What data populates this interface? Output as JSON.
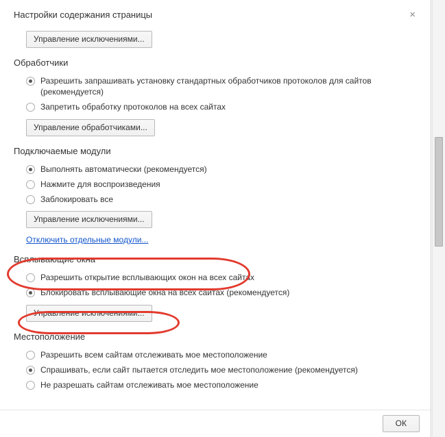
{
  "dialog": {
    "title": "Настройки содержания страницы",
    "close_label": "×"
  },
  "top_section": {
    "manage_exceptions": "Управление исключениями..."
  },
  "handlers": {
    "title": "Обработчики",
    "options": [
      "Разрешить запрашивать установку стандартных обработчиков протоколов для сайтов (рекомендуется)",
      "Запретить обработку протоколов на всех сайтах"
    ],
    "selected": 0,
    "manage": "Управление обработчиками..."
  },
  "plugins": {
    "title": "Подключаемые модули",
    "options": [
      "Выполнять автоматически (рекомендуется)",
      "Нажмите для воспроизведения",
      "Заблокировать все"
    ],
    "selected": 0,
    "manage": "Управление исключениями...",
    "disable_link": "Отключить отдельные модули..."
  },
  "popups": {
    "title": "Всплывающие окна",
    "options": [
      "Разрешить открытие всплывающих окон на всех сайтах",
      "Блокировать всплывающие окна на всех сайтах (рекомендуется)"
    ],
    "selected": 1,
    "manage": "Управление исключениями..."
  },
  "location": {
    "title": "Местоположение",
    "options": [
      "Разрешить всем сайтам отслеживать мое местоположение",
      "Спрашивать, если сайт пытается отследить мое местоположение (рекомендуется)",
      "Не разрешать сайтам отслеживать мое местоположение"
    ],
    "selected": 1
  },
  "footer": {
    "ok": "ОК"
  }
}
